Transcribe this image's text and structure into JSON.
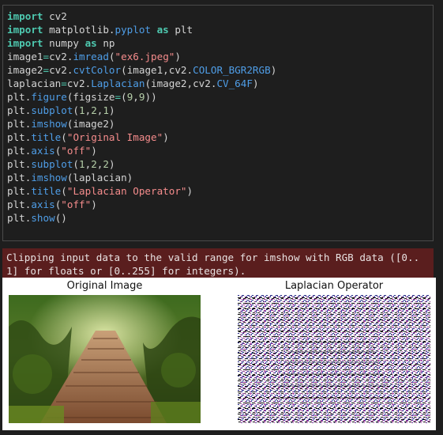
{
  "code_lines": [
    [
      {
        "t": "import",
        "c": "kw"
      },
      {
        "t": " cv2",
        "c": "plain"
      }
    ],
    [
      {
        "t": "import",
        "c": "kw"
      },
      {
        "t": " matplotlib",
        "c": "plain"
      },
      {
        "t": ".",
        "c": "plain"
      },
      {
        "t": "pyplot",
        "c": "attr"
      },
      {
        "t": " ",
        "c": "plain"
      },
      {
        "t": "as",
        "c": "kw2"
      },
      {
        "t": " plt",
        "c": "plain"
      }
    ],
    [
      {
        "t": "import",
        "c": "kw"
      },
      {
        "t": " numpy ",
        "c": "plain"
      },
      {
        "t": "as",
        "c": "kw2"
      },
      {
        "t": " np",
        "c": "plain"
      }
    ],
    [
      {
        "t": "image1",
        "c": "plain"
      },
      {
        "t": "=",
        "c": "op"
      },
      {
        "t": "cv2.",
        "c": "plain"
      },
      {
        "t": "imread",
        "c": "attr"
      },
      {
        "t": "(",
        "c": "plain"
      },
      {
        "t": "\"ex6.jpeg\"",
        "c": "str"
      },
      {
        "t": ")",
        "c": "plain"
      }
    ],
    [
      {
        "t": "image2",
        "c": "plain"
      },
      {
        "t": "=",
        "c": "op"
      },
      {
        "t": "cv2.",
        "c": "plain"
      },
      {
        "t": "cvtColor",
        "c": "attr"
      },
      {
        "t": "(image1,cv2.",
        "c": "plain"
      },
      {
        "t": "COLOR_BGR2RGB",
        "c": "attr"
      },
      {
        "t": ")",
        "c": "plain"
      }
    ],
    [
      {
        "t": "laplacian",
        "c": "plain"
      },
      {
        "t": "=",
        "c": "op"
      },
      {
        "t": "cv2.",
        "c": "plain"
      },
      {
        "t": "Laplacian",
        "c": "attr"
      },
      {
        "t": "(image2,cv2.",
        "c": "plain"
      },
      {
        "t": "CV_64F",
        "c": "attr"
      },
      {
        "t": ")",
        "c": "plain"
      }
    ],
    [
      {
        "t": "plt.",
        "c": "plain"
      },
      {
        "t": "figure",
        "c": "attr"
      },
      {
        "t": "(figsize",
        "c": "plain"
      },
      {
        "t": "=",
        "c": "op"
      },
      {
        "t": "(",
        "c": "plain"
      },
      {
        "t": "9",
        "c": "num"
      },
      {
        "t": ",",
        "c": "plain"
      },
      {
        "t": "9",
        "c": "num"
      },
      {
        "t": "))",
        "c": "plain"
      }
    ],
    [
      {
        "t": "plt.",
        "c": "plain"
      },
      {
        "t": "subplot",
        "c": "attr"
      },
      {
        "t": "(",
        "c": "plain"
      },
      {
        "t": "1",
        "c": "num"
      },
      {
        "t": ",",
        "c": "plain"
      },
      {
        "t": "2",
        "c": "num"
      },
      {
        "t": ",",
        "c": "plain"
      },
      {
        "t": "1",
        "c": "num"
      },
      {
        "t": ")",
        "c": "plain"
      }
    ],
    [
      {
        "t": "plt.",
        "c": "plain"
      },
      {
        "t": "imshow",
        "c": "attr"
      },
      {
        "t": "(image2)",
        "c": "plain"
      }
    ],
    [
      {
        "t": "plt.",
        "c": "plain"
      },
      {
        "t": "title",
        "c": "attr"
      },
      {
        "t": "(",
        "c": "plain"
      },
      {
        "t": "\"Original Image\"",
        "c": "str"
      },
      {
        "t": ")",
        "c": "plain"
      }
    ],
    [
      {
        "t": "plt.",
        "c": "plain"
      },
      {
        "t": "axis",
        "c": "attr"
      },
      {
        "t": "(",
        "c": "plain"
      },
      {
        "t": "\"off\"",
        "c": "str"
      },
      {
        "t": ")",
        "c": "plain"
      }
    ],
    [
      {
        "t": "plt.",
        "c": "plain"
      },
      {
        "t": "subplot",
        "c": "attr"
      },
      {
        "t": "(",
        "c": "plain"
      },
      {
        "t": "1",
        "c": "num"
      },
      {
        "t": ",",
        "c": "plain"
      },
      {
        "t": "2",
        "c": "num"
      },
      {
        "t": ",",
        "c": "plain"
      },
      {
        "t": "2",
        "c": "num"
      },
      {
        "t": ")",
        "c": "plain"
      }
    ],
    [
      {
        "t": "plt.",
        "c": "plain"
      },
      {
        "t": "imshow",
        "c": "attr"
      },
      {
        "t": "(laplacian)",
        "c": "plain"
      }
    ],
    [
      {
        "t": "plt.",
        "c": "plain"
      },
      {
        "t": "title",
        "c": "attr"
      },
      {
        "t": "(",
        "c": "plain"
      },
      {
        "t": "\"Laplacian Operator\"",
        "c": "str"
      },
      {
        "t": ")",
        "c": "plain"
      }
    ],
    [
      {
        "t": "plt.",
        "c": "plain"
      },
      {
        "t": "axis",
        "c": "attr"
      },
      {
        "t": "(",
        "c": "plain"
      },
      {
        "t": "\"off\"",
        "c": "str"
      },
      {
        "t": ")",
        "c": "plain"
      }
    ],
    [
      {
        "t": "plt.",
        "c": "plain"
      },
      {
        "t": "show",
        "c": "attr"
      },
      {
        "t": "()",
        "c": "plain"
      }
    ]
  ],
  "stderr": {
    "line1": "Clipping input data to the valid range for imshow with RGB data ([0..",
    "line2": "1] for floats or [0..255] for integers)."
  },
  "figure": {
    "left_title": "Original Image",
    "right_title": "Laplacian Operator"
  },
  "colors": {
    "editor_bg": "#1e1e1e",
    "stderr_bg": "#5a1e1e",
    "keyword": "#4ec9b0",
    "attribute": "#4f9ee8",
    "string": "#f58c8c",
    "number": "#b5cea8"
  }
}
